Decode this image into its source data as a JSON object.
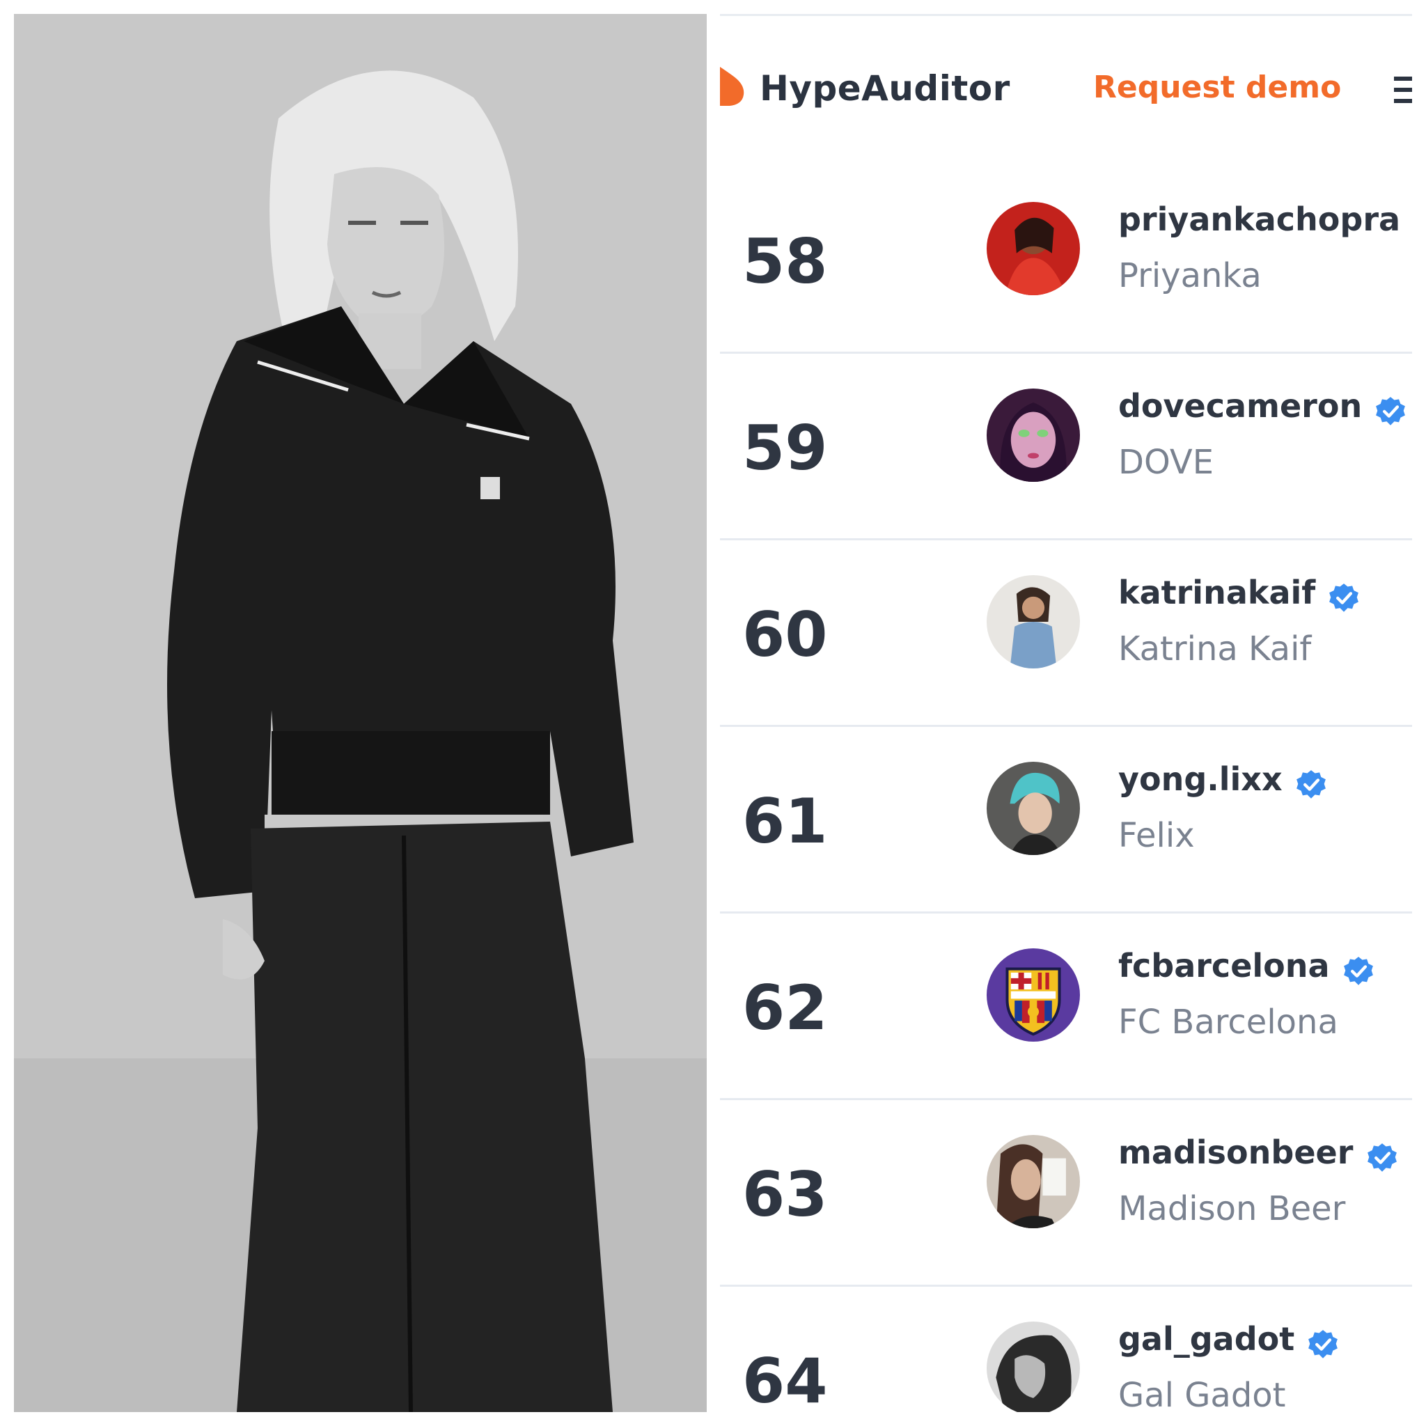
{
  "header": {
    "brand": "HypeAuditor",
    "request_demo": "Request demo"
  },
  "colors": {
    "accent": "#f26b2a",
    "text_dark": "#2f3642",
    "text_muted": "#7a8290",
    "verified": "#3b8ef0",
    "divider": "#e6eaf0"
  },
  "rows": [
    {
      "rank": "58",
      "username": "priyankachopra",
      "name": "Priyanka",
      "verified": true
    },
    {
      "rank": "59",
      "username": "dovecameron",
      "name": "DOVE",
      "verified": true
    },
    {
      "rank": "60",
      "username": "katrinakaif",
      "name": "Katrina Kaif",
      "verified": true
    },
    {
      "rank": "61",
      "username": "yong.lixx",
      "name": "Felix",
      "verified": true
    },
    {
      "rank": "62",
      "username": "fcbarcelona",
      "name": "FC Barcelona",
      "verified": true
    },
    {
      "rank": "63",
      "username": "madisonbeer",
      "name": "Madison Beer",
      "verified": true
    },
    {
      "rank": "64",
      "username": "gal_gadot",
      "name": "Gal Gadot",
      "verified": true
    }
  ]
}
